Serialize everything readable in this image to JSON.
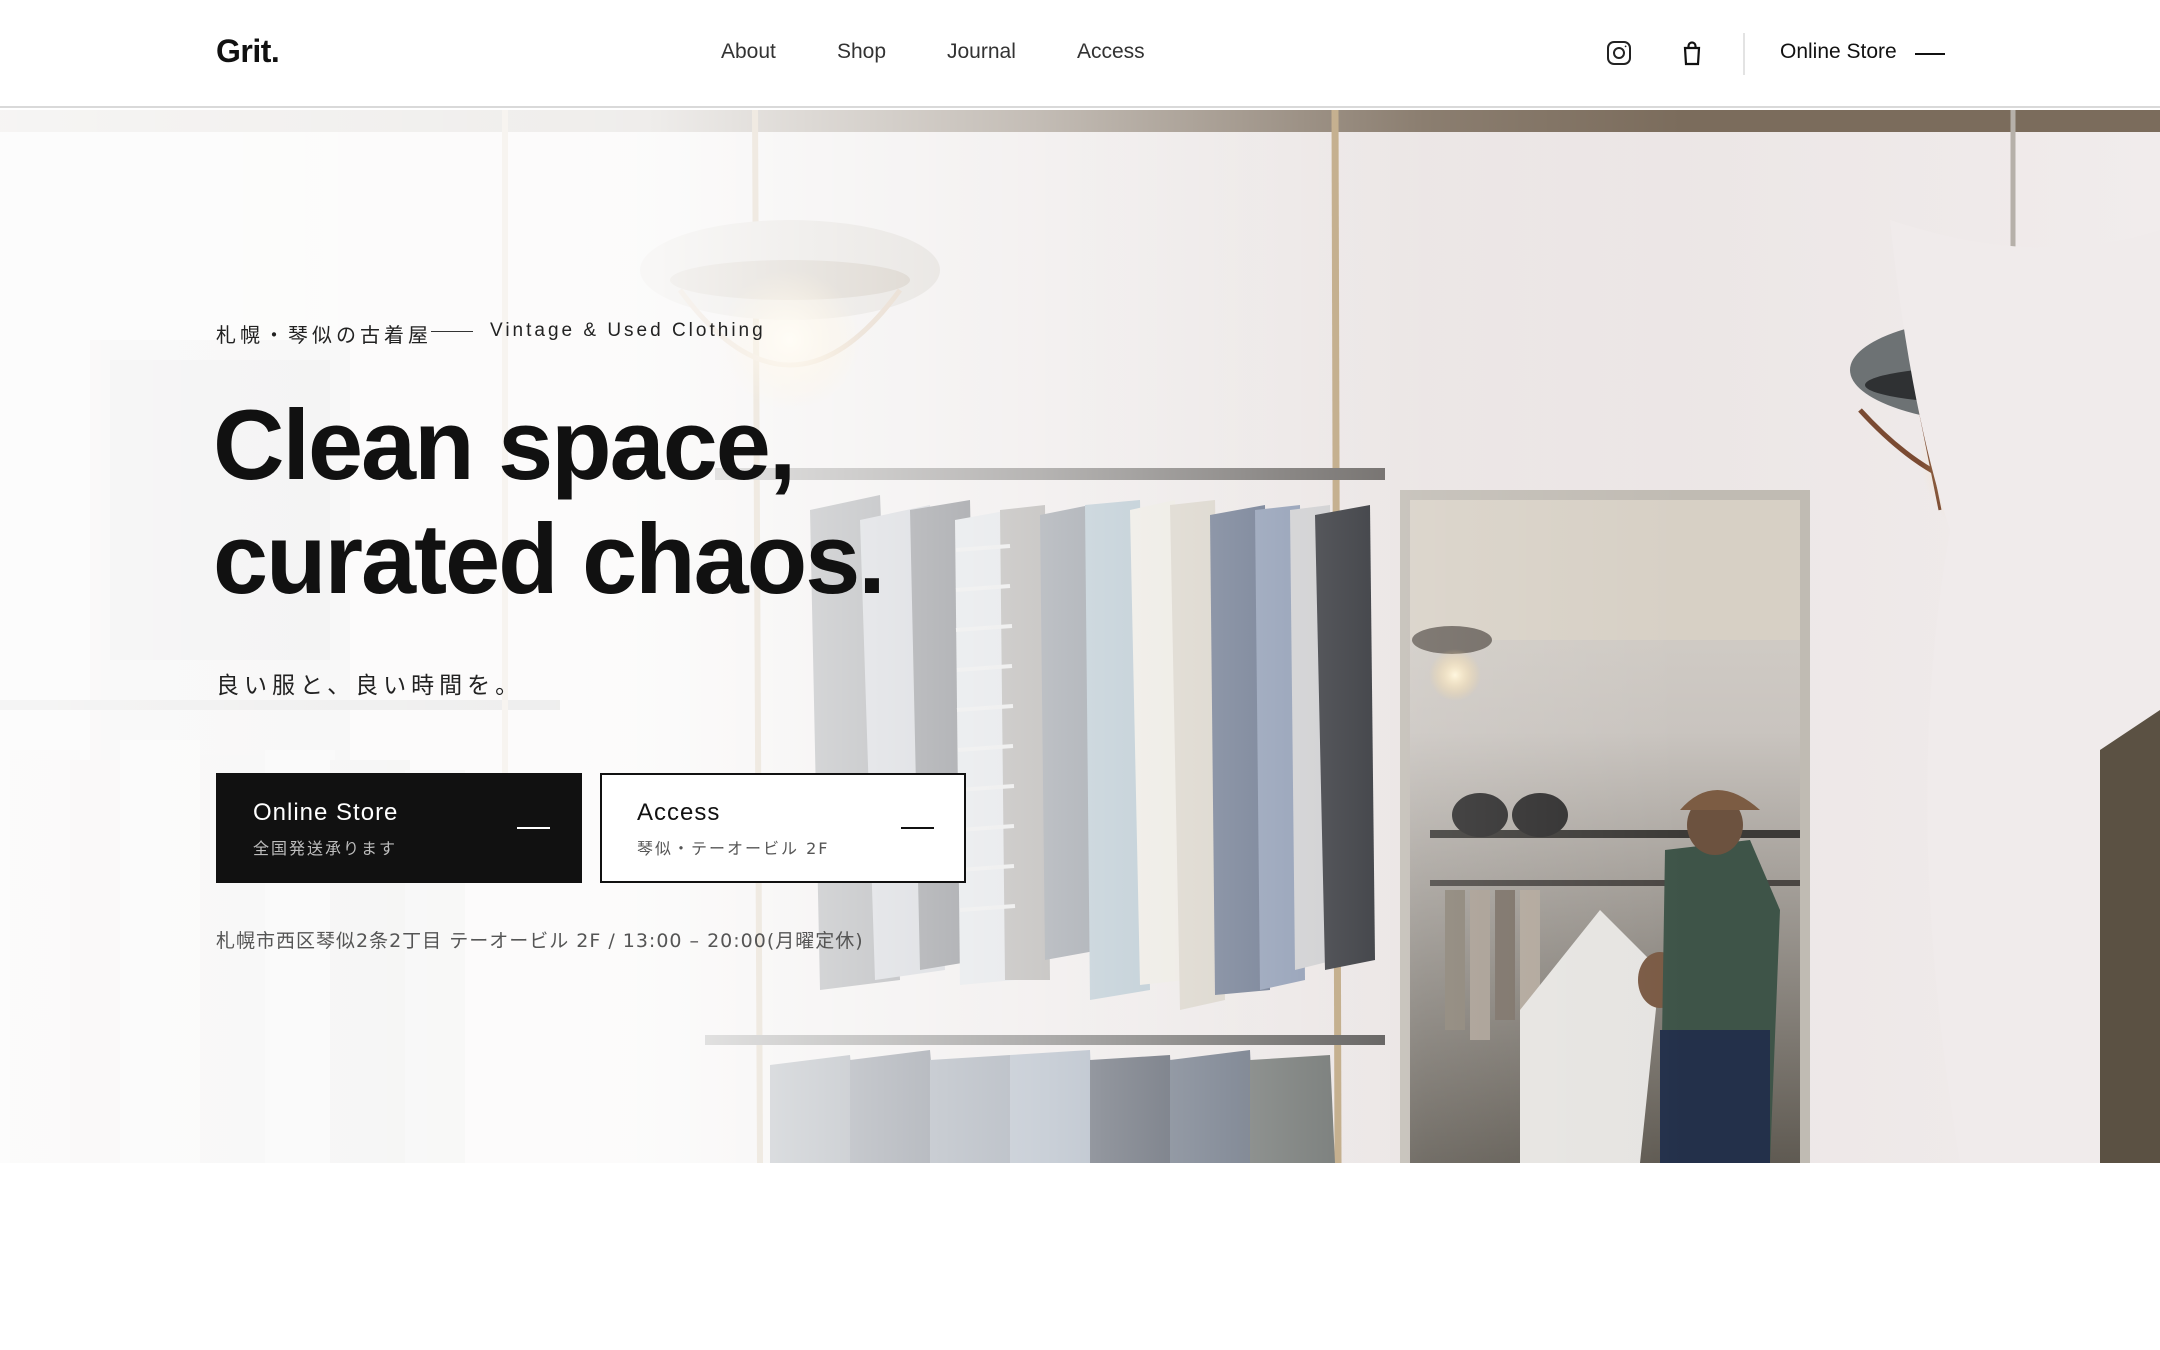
{
  "header": {
    "logo": "Grit.",
    "nav": [
      {
        "label": "About"
      },
      {
        "label": "Shop"
      },
      {
        "label": "Journal"
      },
      {
        "label": "Access"
      }
    ],
    "icons": {
      "instagram": "instagram-icon",
      "cart": "shopping-bag-icon"
    },
    "online_store_label": "Online Store"
  },
  "hero": {
    "eyebrow_jp": "札幌・琴似の古着屋",
    "eyebrow_en": "Vintage & Used Clothing",
    "headline_line1": "Clean space,",
    "headline_line2": "curated chaos.",
    "tagline": "良い服と、良い時間を。",
    "cta_primary": {
      "label": "Online Store",
      "sub": "全国発送承ります"
    },
    "cta_secondary": {
      "label": "Access",
      "sub": "琴似・テーオービル 2F"
    },
    "address": "札幌市西区琴似2条2丁目 テーオービル 2F / 13:00 – 20:00(月曜定休)",
    "background_image": "vintage clothing store interior with hanging lamps, clothing racks and mirror"
  },
  "colors": {
    "text": "#111111",
    "primary_button": "#111111",
    "header_bg": "#ffffff",
    "border": "#d9d9d9"
  }
}
